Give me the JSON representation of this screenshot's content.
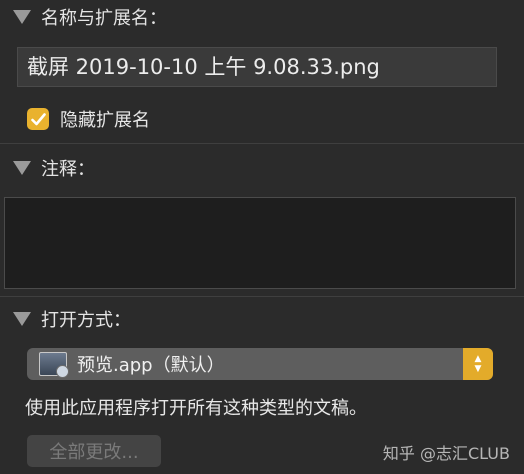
{
  "name_section": {
    "title": "名称与扩展名：",
    "filename": "截屏 2019-10-10 上午 9.08.33.png",
    "hide_extension_label": "隐藏扩展名",
    "hide_extension_checked": true
  },
  "comments_section": {
    "title": "注释：",
    "value": ""
  },
  "open_with_section": {
    "title": "打开方式：",
    "selected_app": "预览.app（默认）",
    "description": "使用此应用程序打开所有这种类型的文稿。",
    "change_all_label": "全部更改..."
  },
  "watermark": "知乎 @志汇CLUB",
  "colors": {
    "background": "#2b2b2b",
    "accent": "#e9b22e",
    "field": "#3a3a3a"
  }
}
